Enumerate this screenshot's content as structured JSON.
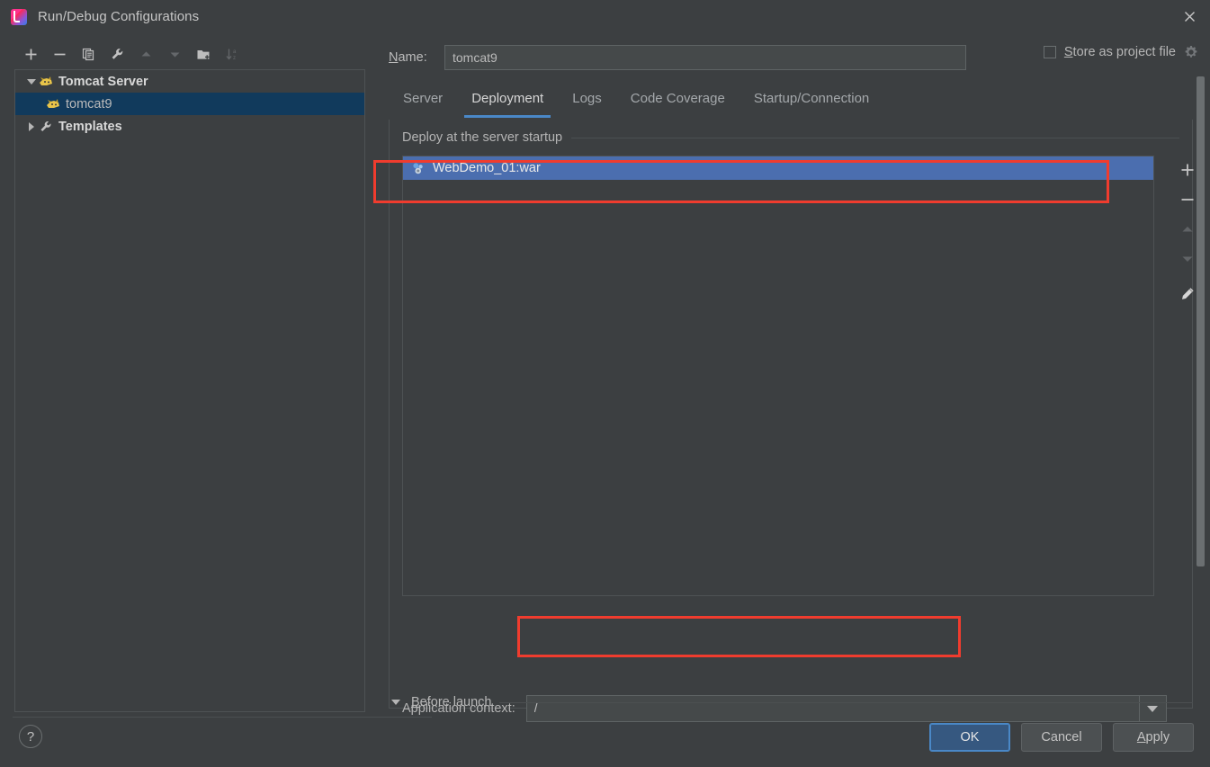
{
  "window": {
    "title": "Run/Debug Configurations",
    "app_icon": "intellij-idea-icon",
    "close_icon": "close-icon"
  },
  "left_panel": {
    "toolbar": [
      {
        "name": "add-configuration-button",
        "icon": "plus-icon",
        "enabled": true
      },
      {
        "name": "remove-configuration-button",
        "icon": "minus-icon",
        "enabled": true
      },
      {
        "name": "copy-configuration-button",
        "icon": "copy-icon",
        "enabled": true
      },
      {
        "name": "edit-templates-button",
        "icon": "wrench-icon",
        "enabled": true
      },
      {
        "name": "move-up-button",
        "icon": "arrow-up-icon",
        "enabled": false
      },
      {
        "name": "move-down-button",
        "icon": "arrow-down-icon",
        "enabled": false
      },
      {
        "name": "move-into-folder-button",
        "icon": "new-folder-icon",
        "enabled": true
      },
      {
        "name": "sort-configurations-button",
        "icon": "sort-alpha-icon",
        "enabled": false
      }
    ],
    "tree": [
      {
        "label": "Tomcat Server",
        "icon": "tomcat-icon",
        "expanded": true,
        "level": 0,
        "selected": false,
        "bold": true
      },
      {
        "label": "tomcat9",
        "icon": "tomcat-icon",
        "level": 1,
        "selected": true,
        "bold": false
      },
      {
        "label": "Templates",
        "icon": "wrench-icon",
        "expanded": false,
        "level": 0,
        "selected": false,
        "bold": true
      }
    ]
  },
  "name_row": {
    "label": "Name:",
    "label_mnemonic": "N",
    "value": "tomcat9",
    "placeholder": "",
    "store_as_project_file": {
      "label": "Store as project file",
      "label_mnemonic": "S",
      "checked": false,
      "gear_icon": "gear-icon"
    }
  },
  "tabs": [
    {
      "label": "Server",
      "active": false
    },
    {
      "label": "Deployment",
      "active": true
    },
    {
      "label": "Logs",
      "active": false
    },
    {
      "label": "Code Coverage",
      "active": false
    },
    {
      "label": "Startup/Connection",
      "active": false
    }
  ],
  "deployment": {
    "section_title": "Deploy at the server startup",
    "items": [
      {
        "label": "WebDemo_01:war",
        "icon": "artifact-icon",
        "selected": true
      }
    ],
    "side_buttons": [
      {
        "name": "add-artifact-button",
        "icon": "plus-icon",
        "enabled": true
      },
      {
        "name": "remove-artifact-button",
        "icon": "minus-icon",
        "enabled": true
      },
      {
        "name": "move-artifact-up-button",
        "icon": "arrow-up-icon",
        "enabled": false
      },
      {
        "name": "move-artifact-down-button",
        "icon": "arrow-down-icon",
        "enabled": false
      },
      {
        "name": "edit-artifact-button",
        "icon": "pencil-icon",
        "enabled": true
      }
    ],
    "application_context": {
      "label": "Application context:",
      "value": "/",
      "placeholder": "",
      "dropdown_icon": "chevron-down-icon"
    }
  },
  "before_launch": {
    "label": "Before launch",
    "label_mnemonic": "B",
    "expanded": true
  },
  "footer": {
    "help_label": "?",
    "buttons": [
      {
        "name": "ok-button",
        "label": "OK",
        "primary": true
      },
      {
        "name": "cancel-button",
        "label": "Cancel",
        "primary": false
      },
      {
        "name": "apply-button",
        "label": "Apply",
        "primary": false,
        "mnemonic": "A"
      }
    ]
  },
  "annotations": [
    {
      "name": "deployment-artifact-highlight",
      "color": "#f03c2e"
    },
    {
      "name": "application-context-highlight",
      "color": "#f03c2e"
    }
  ],
  "colors": {
    "dialog_bg": "#3c3f41",
    "selection_blue": "#4b6eaf",
    "tree_selection": "#113a5c",
    "accent_tab": "#4a88c7",
    "primary_button": "#365880",
    "annotation_red": "#f03c2e"
  }
}
